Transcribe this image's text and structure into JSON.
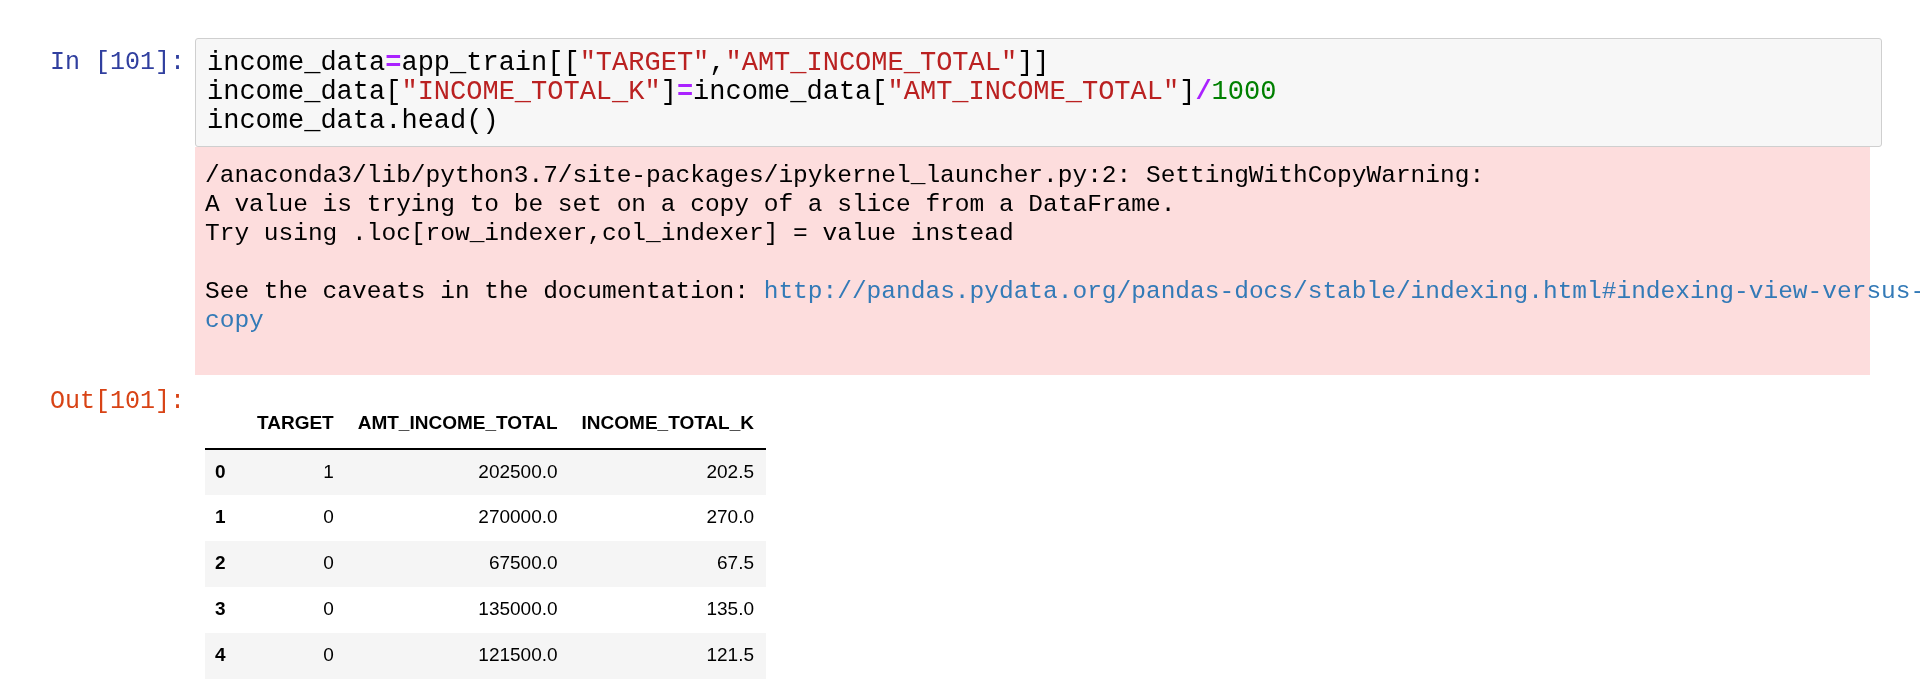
{
  "input_cell": {
    "prompt": "In [101]:",
    "lines": [
      [
        {
          "kind": "name",
          "text": "income_data"
        },
        {
          "kind": "op",
          "text": "="
        },
        {
          "kind": "name",
          "text": "app_train[["
        },
        {
          "kind": "str",
          "text": "\"TARGET\""
        },
        {
          "kind": "name",
          "text": ","
        },
        {
          "kind": "str",
          "text": "\"AMT_INCOME_TOTAL\""
        },
        {
          "kind": "name",
          "text": "]]"
        }
      ],
      [
        {
          "kind": "name",
          "text": "income_data["
        },
        {
          "kind": "str",
          "text": "\"INCOME_TOTAL_K\""
        },
        {
          "kind": "name",
          "text": "]"
        },
        {
          "kind": "op",
          "text": "="
        },
        {
          "kind": "name",
          "text": "income_data["
        },
        {
          "kind": "str",
          "text": "\"AMT_INCOME_TOTAL\""
        },
        {
          "kind": "name",
          "text": "]"
        },
        {
          "kind": "op",
          "text": "/"
        },
        {
          "kind": "num",
          "text": "1000"
        }
      ],
      [
        {
          "kind": "name",
          "text": "income_data.head()"
        }
      ]
    ]
  },
  "warning": {
    "lines": [
      "/anaconda3/lib/python3.7/site-packages/ipykernel_launcher.py:2: SettingWithCopyWarning:",
      "A value is trying to be set on a copy of a slice from a DataFrame.",
      "Try using .loc[row_indexer,col_indexer] = value instead"
    ],
    "see_text": "See the caveats in the documentation:",
    "link": [
      "http://pandas.pydata.org/pandas-docs/stable/indexing.html#indexing-view-versus-",
      "copy"
    ]
  },
  "output_cell": {
    "prompt": "Out[101]:",
    "table": {
      "columns": [
        "TARGET",
        "AMT_INCOME_TOTAL",
        "INCOME_TOTAL_K"
      ],
      "rows": [
        {
          "index": "0",
          "cells": [
            "1",
            "202500.0",
            "202.5"
          ]
        },
        {
          "index": "1",
          "cells": [
            "0",
            "270000.0",
            "270.0"
          ]
        },
        {
          "index": "2",
          "cells": [
            "0",
            "67500.0",
            "67.5"
          ]
        },
        {
          "index": "3",
          "cells": [
            "0",
            "135000.0",
            "135.0"
          ]
        },
        {
          "index": "4",
          "cells": [
            "0",
            "121500.0",
            "121.5"
          ]
        }
      ]
    }
  }
}
